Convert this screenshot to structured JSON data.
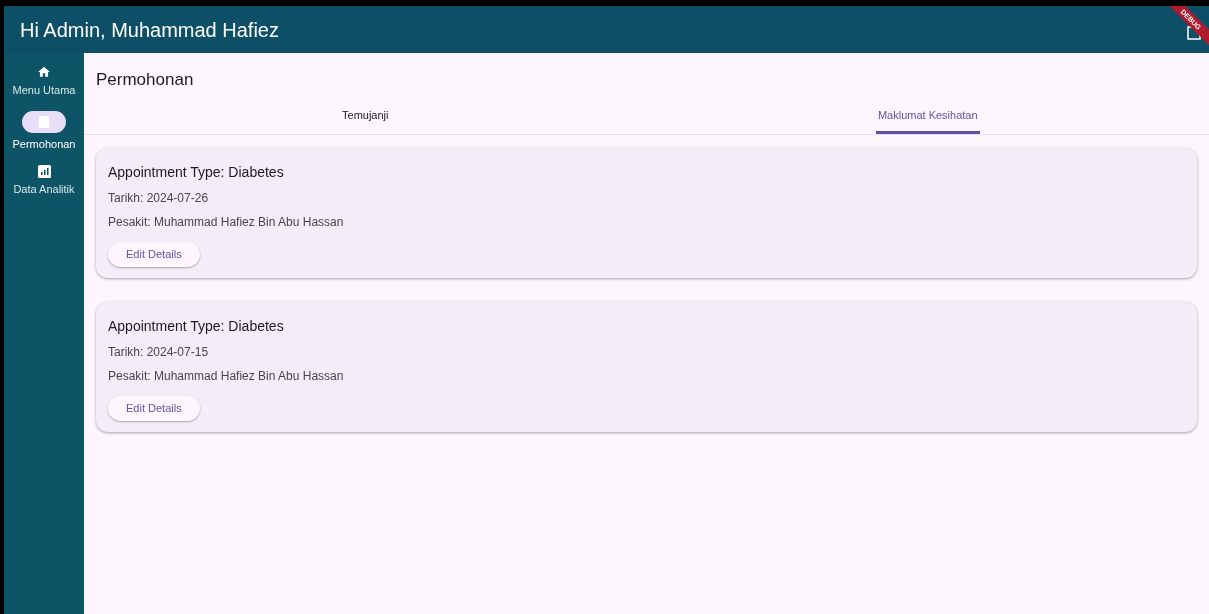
{
  "app_bar": {
    "title": "Hi Admin, Muhammad Hafiez",
    "debug_banner": "DEBUG"
  },
  "sidebar": {
    "items": [
      {
        "kind": "home",
        "label": "Menu Utama",
        "selected": false
      },
      {
        "kind": "document",
        "label": "Permohonan",
        "selected": true
      },
      {
        "kind": "chart",
        "label": "Data Analitik",
        "selected": false
      }
    ]
  },
  "page_title": "Permohonan",
  "tabs": [
    {
      "label": "Temujanji",
      "selected": false
    },
    {
      "label": "Maklumat Kesihatan",
      "selected": true
    }
  ],
  "cards": [
    {
      "title": "Appointment Type: Diabetes",
      "date": "Tarikh: 2024-07-26",
      "patient": "Pesakit: Muhammad Hafiez Bin Abu Hassan",
      "button": "Edit Details"
    },
    {
      "title": "Appointment Type: Diabetes",
      "date": "Tarikh: 2024-07-15",
      "patient": "Pesakit: Muhammad Hafiez Bin Abu Hassan",
      "button": "Edit Details"
    }
  ]
}
